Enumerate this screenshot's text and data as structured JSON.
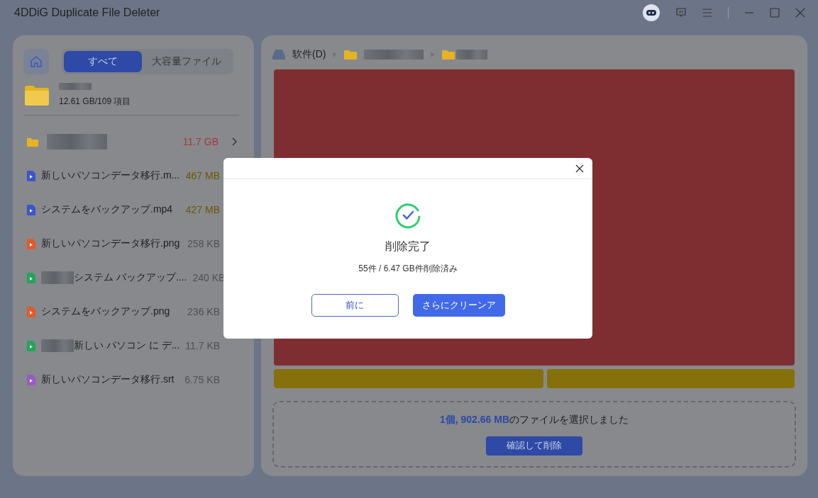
{
  "window": {
    "title": "4DDiG Duplicate File Deleter"
  },
  "sidebar": {
    "tabs": [
      {
        "label": "すべて",
        "selected": true
      },
      {
        "label": "大容量ファイル",
        "selected": false
      }
    ],
    "folder_summary": "12.61 GB/109 項目",
    "items": [
      {
        "kind": "folder",
        "blurred_prefix": true,
        "size": "11.7 GB",
        "color": "#a83838",
        "expandable": true
      },
      {
        "kind": "video",
        "blurred_prefix": false,
        "name": "新しいパソコンデータ移行.m...",
        "size": "467 MB",
        "color": "#6b5800",
        "expandable": false
      },
      {
        "kind": "video",
        "blurred_prefix": false,
        "name": "システムをバックアップ.mp4",
        "size": "427 MB",
        "color": "#6b5800",
        "expandable": false
      },
      {
        "kind": "image",
        "blurred_prefix": false,
        "name": "新しいパソコンデータ移行.png",
        "size": "258 KB",
        "color": "#505050",
        "expandable": false
      },
      {
        "kind": "doc",
        "blurred_prefix": true,
        "name": "システム バックアップ....",
        "size": "240 KB",
        "color": "#505050",
        "expandable": false
      },
      {
        "kind": "image",
        "blurred_prefix": false,
        "name": "システムをバックアップ.png",
        "size": "236 KB",
        "color": "#505050",
        "expandable": false
      },
      {
        "kind": "doc",
        "blurred_prefix": true,
        "name": "新しい パソコン に デ...",
        "size": "11.7 KB",
        "color": "#505050",
        "expandable": false
      },
      {
        "kind": "subtitle",
        "blurred_prefix": false,
        "name": "新しいパソコンデータ移行.srt",
        "size": "6.75 KB",
        "color": "#505050",
        "expandable": false
      }
    ]
  },
  "breadcrumb": [
    {
      "kind": "drive",
      "label": "软件(D)"
    },
    {
      "kind": "folder"
    },
    {
      "kind": "folder"
    }
  ],
  "treemap": {
    "tiles": [
      {
        "color": "#7e2e31"
      },
      {
        "color": "#86700c"
      },
      {
        "color": "#86700c"
      }
    ]
  },
  "selection": {
    "summary": "**1個, 902.66 MB**のファイルを選択しました",
    "button": "確認して削除"
  },
  "dialog": {
    "title": "削除完了",
    "message": "55件 / 6.47 GB件削除済み",
    "buttons": [
      {
        "label": "前に",
        "kind": "secondary"
      },
      {
        "label": "さらにクリーンア",
        "kind": "primary"
      }
    ]
  }
}
